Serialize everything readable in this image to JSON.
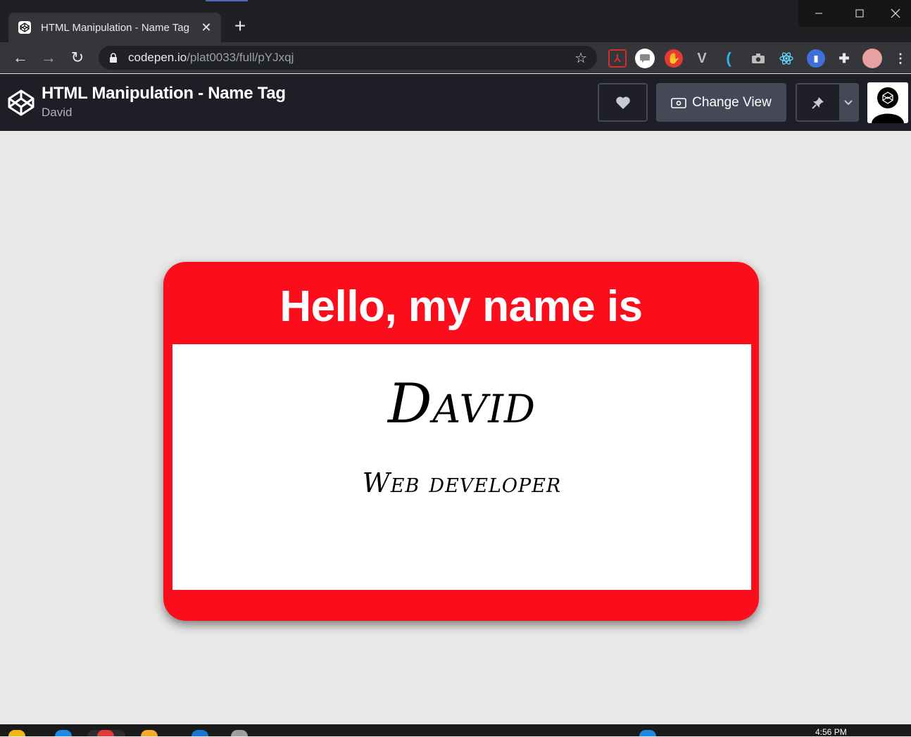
{
  "browser": {
    "tab": {
      "title": "HTML Manipulation - Name Tag",
      "close": "✕"
    },
    "new_tab": "+",
    "window": {
      "minimize": "—",
      "maximize": "☐",
      "close": "✕"
    },
    "nav": {
      "back": "←",
      "forward": "→",
      "reload": "↻"
    },
    "url": {
      "host": "codepen.io",
      "path": "/plat0033/full/pYJxqj"
    },
    "star": "☆",
    "extensions": [
      "pdf-icon",
      "chat-icon",
      "stop-hand-icon",
      "vue-icon",
      "c-icon",
      "camera-icon",
      "react-icon",
      "doc-icon",
      "puzzle-icon",
      "profile-icon",
      "menu-dots-icon"
    ]
  },
  "codepen": {
    "title": "HTML Manipulation - Name Tag",
    "author": "David",
    "change_view_label": "Change View"
  },
  "nametag": {
    "greeting": "Hello, my name is",
    "name": "David",
    "role": "Web developer",
    "colors": {
      "border": "#fc0d1b",
      "body": "#ffffff",
      "text": "#000000"
    }
  },
  "taskbar": {
    "clock": "4:56 PM"
  }
}
